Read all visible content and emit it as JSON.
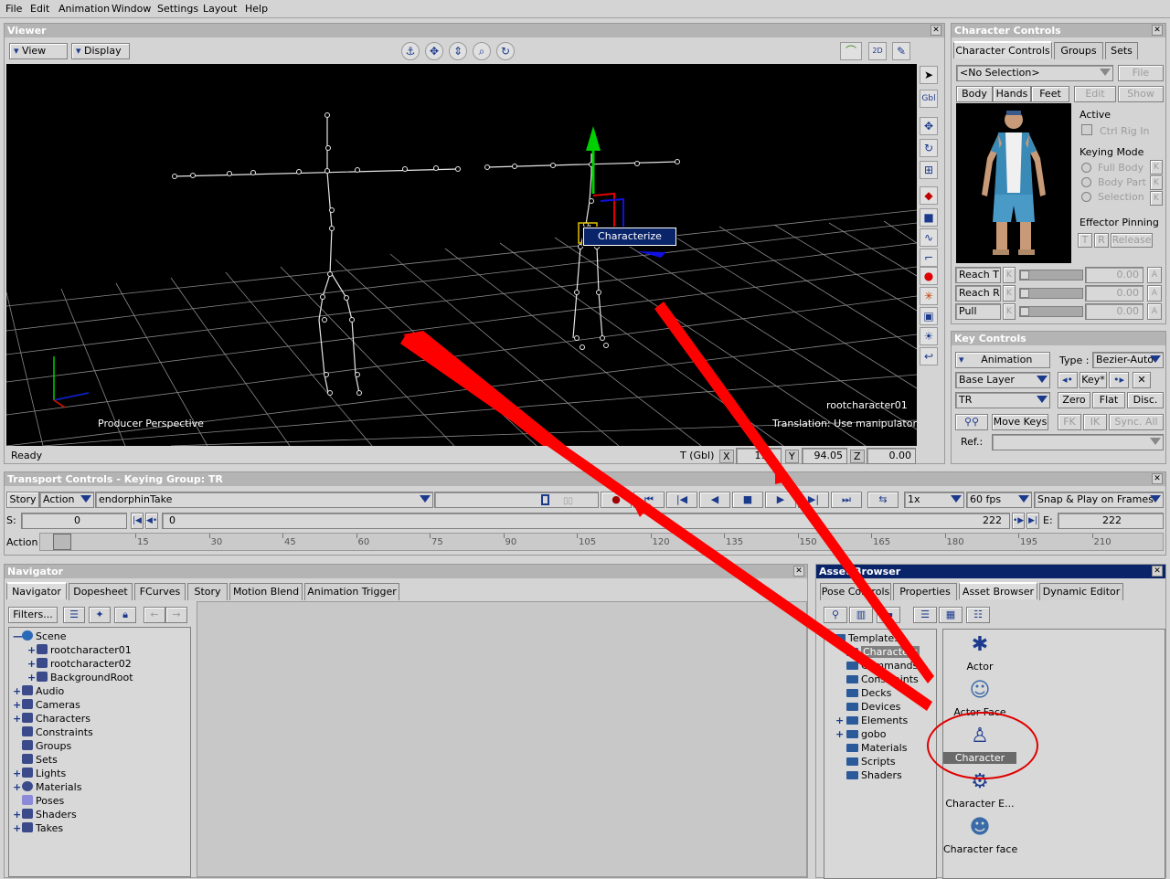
{
  "menu": [
    "File",
    "Edit",
    "Animation",
    "Window",
    "Settings",
    "Layout",
    "Help"
  ],
  "viewer": {
    "title": "Viewer",
    "view_btn": "View",
    "display_btn": "Display",
    "perspective": "Producer Perspective",
    "translation": "Translation: Use manipulator",
    "root_label": "rootcharacter01",
    "context_item": "Characterize",
    "status": "Ready",
    "coord_label": "T (Gbl)",
    "x_label": "X",
    "x_value": "199.",
    "y_label": "Y",
    "y_value": "94.05",
    "z_label": "Z",
    "z_value": "0.00",
    "gbl_btn": "Gbl"
  },
  "character_controls": {
    "title": "Character Controls",
    "tabs": [
      "Character Controls",
      "Groups",
      "Sets"
    ],
    "selection": "<No Selection>",
    "file_btn": "File",
    "body_tabs": [
      "Body",
      "Hands",
      "Feet"
    ],
    "edit_btn": "Edit",
    "show_btn": "Show",
    "active_label": "Active",
    "ctrl_rig": "Ctrl Rig In",
    "keying_mode_label": "Keying Mode",
    "modes": [
      "Full Body",
      "Body Part",
      "Selection"
    ],
    "k": "K",
    "effector_label": "Effector Pinning",
    "t_btn": "T",
    "r_btn": "R",
    "release_btn": "Release",
    "sliders": [
      {
        "label": "Reach T",
        "value": "0.00"
      },
      {
        "label": "Reach R",
        "value": "0.00"
      },
      {
        "label": "Pull",
        "value": "0.00"
      }
    ],
    "a": "A"
  },
  "key_controls": {
    "title": "Key Controls",
    "animation": "Animation",
    "type_label": "Type :",
    "type_value": "Bezier-Auto",
    "layer": "Base Layer",
    "key_btn": "Key*",
    "tr": "TR",
    "zero": "Zero",
    "flat": "Flat",
    "disc": "Disc.",
    "move_keys": "Move Keys",
    "fk": "FK",
    "ik": "IK",
    "sync": "Sync. All",
    "ref_label": "Ref.:"
  },
  "transport": {
    "title": "Transport Controls  -  Keying Group: TR",
    "story": "Story",
    "action_mode": "Action",
    "take": "endorphinTake",
    "speed": "1x",
    "fps": "60 fps",
    "snap": "Snap & Play on Frames",
    "s_label": "S:",
    "s_value": "0",
    "cur_value": "0",
    "end_value": "222",
    "e_label": "E:",
    "e_value": "222",
    "action_label": "Action",
    "ticks": [
      "15",
      "30",
      "45",
      "60",
      "75",
      "90",
      "105",
      "120",
      "135",
      "150",
      "165",
      "180",
      "195",
      "210"
    ]
  },
  "navigator": {
    "title": "Navigator",
    "tabs": [
      "Navigator",
      "Dopesheet",
      "FCurves",
      "Story",
      "Motion Blend",
      "Animation Trigger"
    ],
    "filters": "Filters...",
    "tree": [
      {
        "label": "Scene",
        "indent": 0,
        "pl": "—"
      },
      {
        "label": "rootcharacter01",
        "indent": 1,
        "pl": "+"
      },
      {
        "label": "rootcharacter02",
        "indent": 1,
        "pl": "+"
      },
      {
        "label": "BackgroundRoot",
        "indent": 1,
        "pl": "+"
      },
      {
        "label": "Audio",
        "indent": 0,
        "pl": "+"
      },
      {
        "label": "Cameras",
        "indent": 0,
        "pl": "+"
      },
      {
        "label": "Characters",
        "indent": 0,
        "pl": "+"
      },
      {
        "label": "Constraints",
        "indent": 0,
        "pl": ""
      },
      {
        "label": "Groups",
        "indent": 0,
        "pl": ""
      },
      {
        "label": "Sets",
        "indent": 0,
        "pl": ""
      },
      {
        "label": "Lights",
        "indent": 0,
        "pl": "+"
      },
      {
        "label": "Materials",
        "indent": 0,
        "pl": "+"
      },
      {
        "label": "Poses",
        "indent": 0,
        "pl": ""
      },
      {
        "label": "Shaders",
        "indent": 0,
        "pl": "+"
      },
      {
        "label": "Takes",
        "indent": 0,
        "pl": "+"
      }
    ]
  },
  "asset_browser": {
    "title": "Asset Browser",
    "tabs": [
      "Pose Controls",
      "Properties",
      "Asset Browser",
      "Dynamic Editor"
    ],
    "folders": [
      "Templates",
      "Characters",
      "Commands",
      "Constraints",
      "Decks",
      "Devices",
      "Elements",
      "gobo",
      "Materials",
      "Scripts",
      "Shaders"
    ],
    "assets": [
      "Actor",
      "Actor Face",
      "Character",
      "Character E...",
      "Character face"
    ]
  }
}
